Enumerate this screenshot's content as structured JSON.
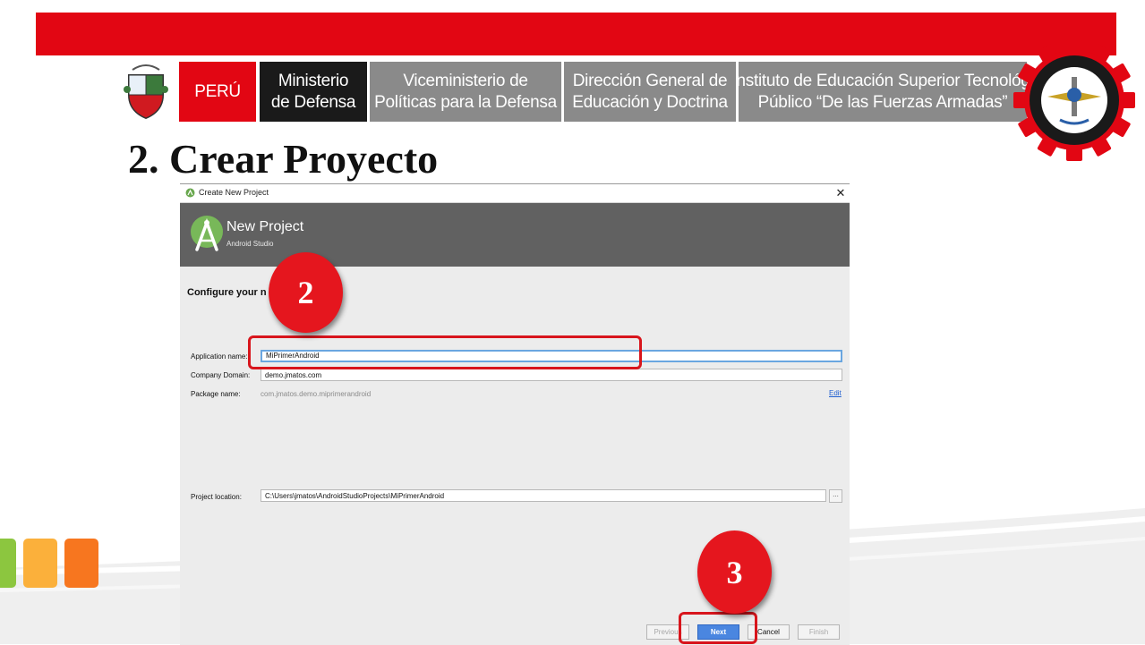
{
  "slide": {
    "header": {
      "peru": "PERÚ",
      "ministerio": "Ministerio\nde Defensa",
      "viceministerio": "Viceministerio de\nPolíticas para la Defensa",
      "direccion": "Dirección General de\nEducación y Doctrina",
      "instituto": "Instituto de Educación Superior Tecnológi\nPúblico “De las Fuerzas Armadas”"
    },
    "title": "2. Crear Proyecto",
    "colors": {
      "brand_red": "#e20613",
      "dark_box": "#1a1a1a",
      "gray_box": "#8a8a8a",
      "accent_green": "#8cc63f",
      "accent_yellow": "#fbb03b",
      "accent_orange": "#f7761f"
    }
  },
  "dialog": {
    "window_title": "Create New Project",
    "banner_title": "New Project",
    "banner_subtitle": "Android Studio",
    "heading": "Configure your n",
    "fields": {
      "app_name_label": "Application name:",
      "app_name_value": "MiPrimerAndroid",
      "company_domain_label": "Company Domain:",
      "company_domain_value": "demo.jmatos.com",
      "package_name_label": "Package name:",
      "package_name_value": "com.jmatos.demo.miprimerandroid",
      "edit_link": "Edit",
      "project_location_label": "Project location:",
      "project_location_value": "C:\\Users\\jmatos\\AndroidStudioProjects\\MiPrimerAndroid",
      "browse_label": "..."
    },
    "buttons": {
      "previous": "Previous",
      "next": "Next",
      "cancel": "Cancel",
      "finish": "Finish"
    }
  },
  "annotations": {
    "badge_step_2": "2",
    "badge_step_3": "3",
    "highlight_color": "#d8151c"
  }
}
